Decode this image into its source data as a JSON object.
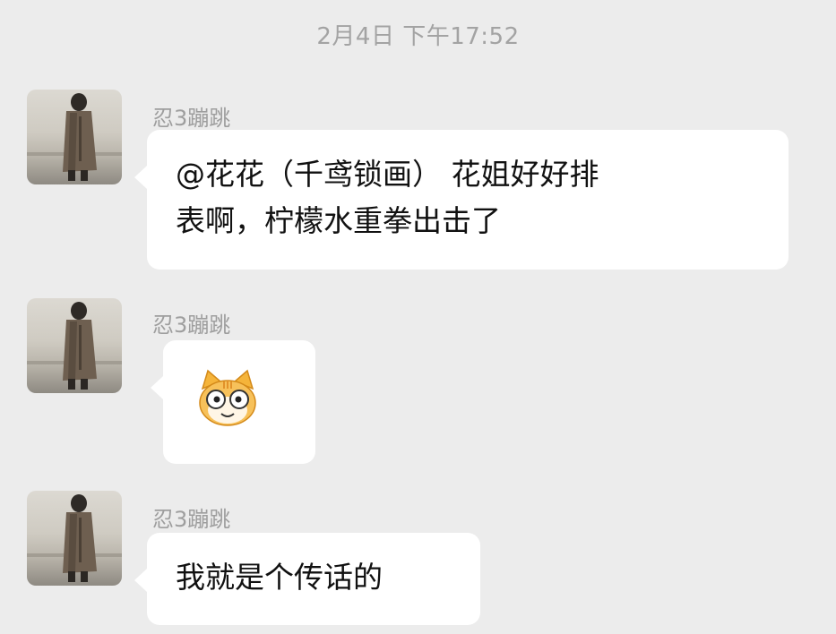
{
  "timestamp": "2月4日 下午17:52",
  "messages": [
    {
      "sender": "忍3蹦跳",
      "text_line1": "@花花（千鸢锁画） 花姐好好排",
      "text_line2": "表啊，柠檬水重拳出击了",
      "type": "text"
    },
    {
      "sender": "忍3蹦跳",
      "type": "sticker",
      "sticker": "cat-emoji-icon"
    },
    {
      "sender": "忍3蹦跳",
      "text_line1": "我就是个传话的",
      "type": "text"
    }
  ],
  "colors": {
    "background": "#ececec",
    "bubble": "#ffffff",
    "sender_name": "#9e9e9e",
    "timestamp": "#a3a3a3",
    "text": "#111111"
  }
}
